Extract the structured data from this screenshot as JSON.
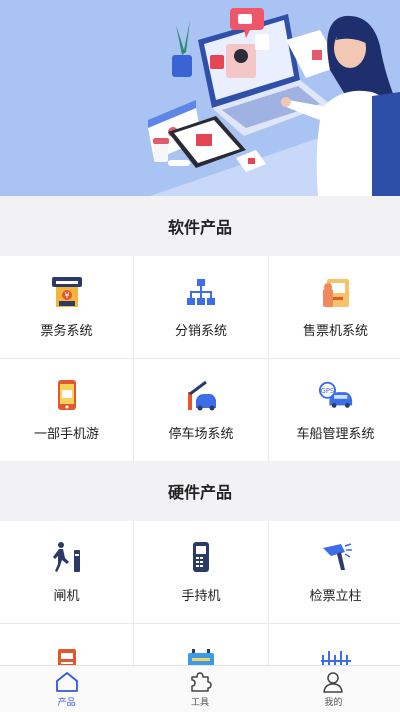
{
  "banner": {
    "illustration": "customer-service-illustration"
  },
  "sections": [
    {
      "title": "软件产品",
      "items": [
        {
          "label": "票务系统",
          "icon": "ticket-machine-icon"
        },
        {
          "label": "分销系统",
          "icon": "hierarchy-icon"
        },
        {
          "label": "售票机系统",
          "icon": "kiosk-icon"
        },
        {
          "label": "一部手机游",
          "icon": "mobile-phone-icon"
        },
        {
          "label": "停车场系统",
          "icon": "parking-barrier-icon"
        },
        {
          "label": "车船管理系统",
          "icon": "vehicle-ship-icon"
        }
      ]
    },
    {
      "title": "硬件产品",
      "items": [
        {
          "label": "闸机",
          "icon": "turnstile-icon"
        },
        {
          "label": "手持机",
          "icon": "handheld-terminal-icon"
        },
        {
          "label": "检票立柱",
          "icon": "scanner-pillar-icon"
        },
        {
          "label": "",
          "icon": "printer-icon"
        },
        {
          "label": "",
          "icon": "display-panel-icon"
        },
        {
          "label": "",
          "icon": "gate-fence-icon"
        }
      ]
    }
  ],
  "tabbar": [
    {
      "label": "产品",
      "icon": "home-icon",
      "active": true
    },
    {
      "label": "工具",
      "icon": "puzzle-icon",
      "active": false
    },
    {
      "label": "我的",
      "icon": "user-icon",
      "active": false
    }
  ],
  "colors": {
    "accent": "#2f5bd8",
    "banner_bg": "#a9c3f3"
  }
}
